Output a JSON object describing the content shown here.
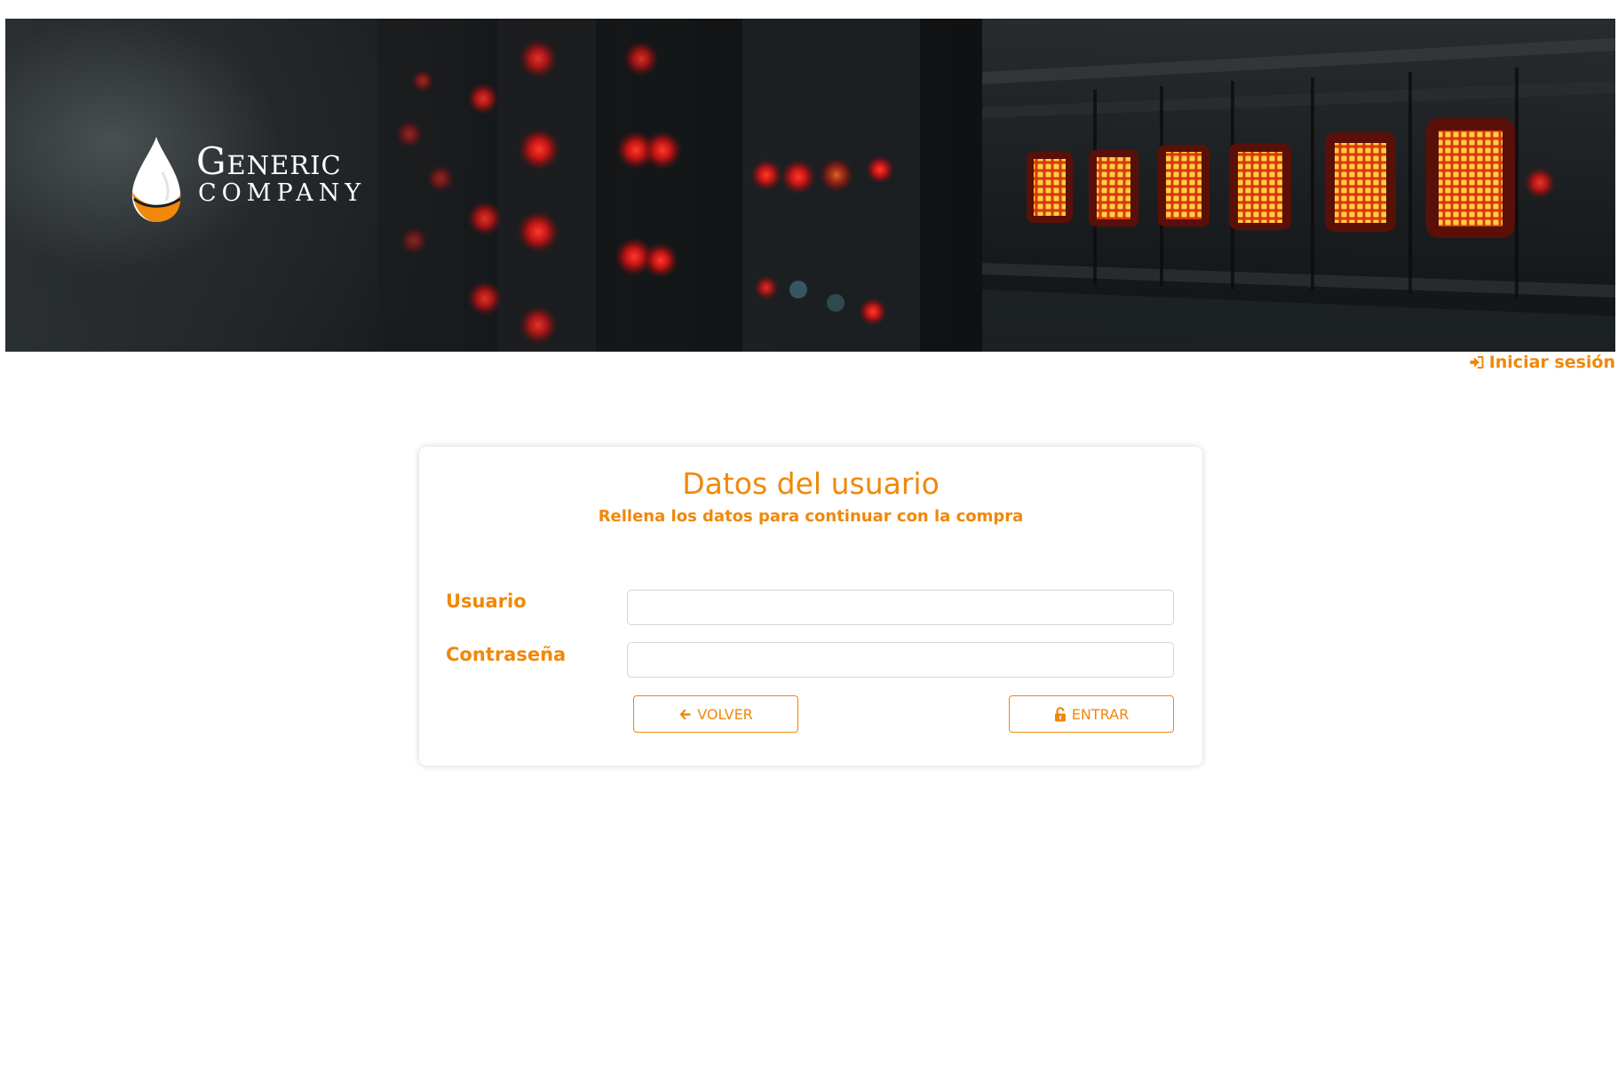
{
  "brand": {
    "name_line_1": "Generic",
    "name_line_2": "COMPANY"
  },
  "header": {
    "login_link_label": "Iniciar sesión",
    "login_icon": "sign-in-icon"
  },
  "card": {
    "title": "Datos del usuario",
    "subtitle": "Rellena los datos para continuar con la compra",
    "fields": {
      "username": {
        "label": "Usuario",
        "value": "",
        "placeholder": ""
      },
      "password": {
        "label": "Contraseña",
        "value": "",
        "placeholder": ""
      }
    },
    "buttons": {
      "back": {
        "label": "VOLVER",
        "icon": "arrow-left-icon"
      },
      "enter": {
        "label": "ENTRAR",
        "icon": "unlock-icon"
      }
    }
  },
  "colors": {
    "accent": "#f0880a",
    "hero_dark": "#121416",
    "led_red": "#e81818",
    "led_orange": "#ffb020"
  }
}
